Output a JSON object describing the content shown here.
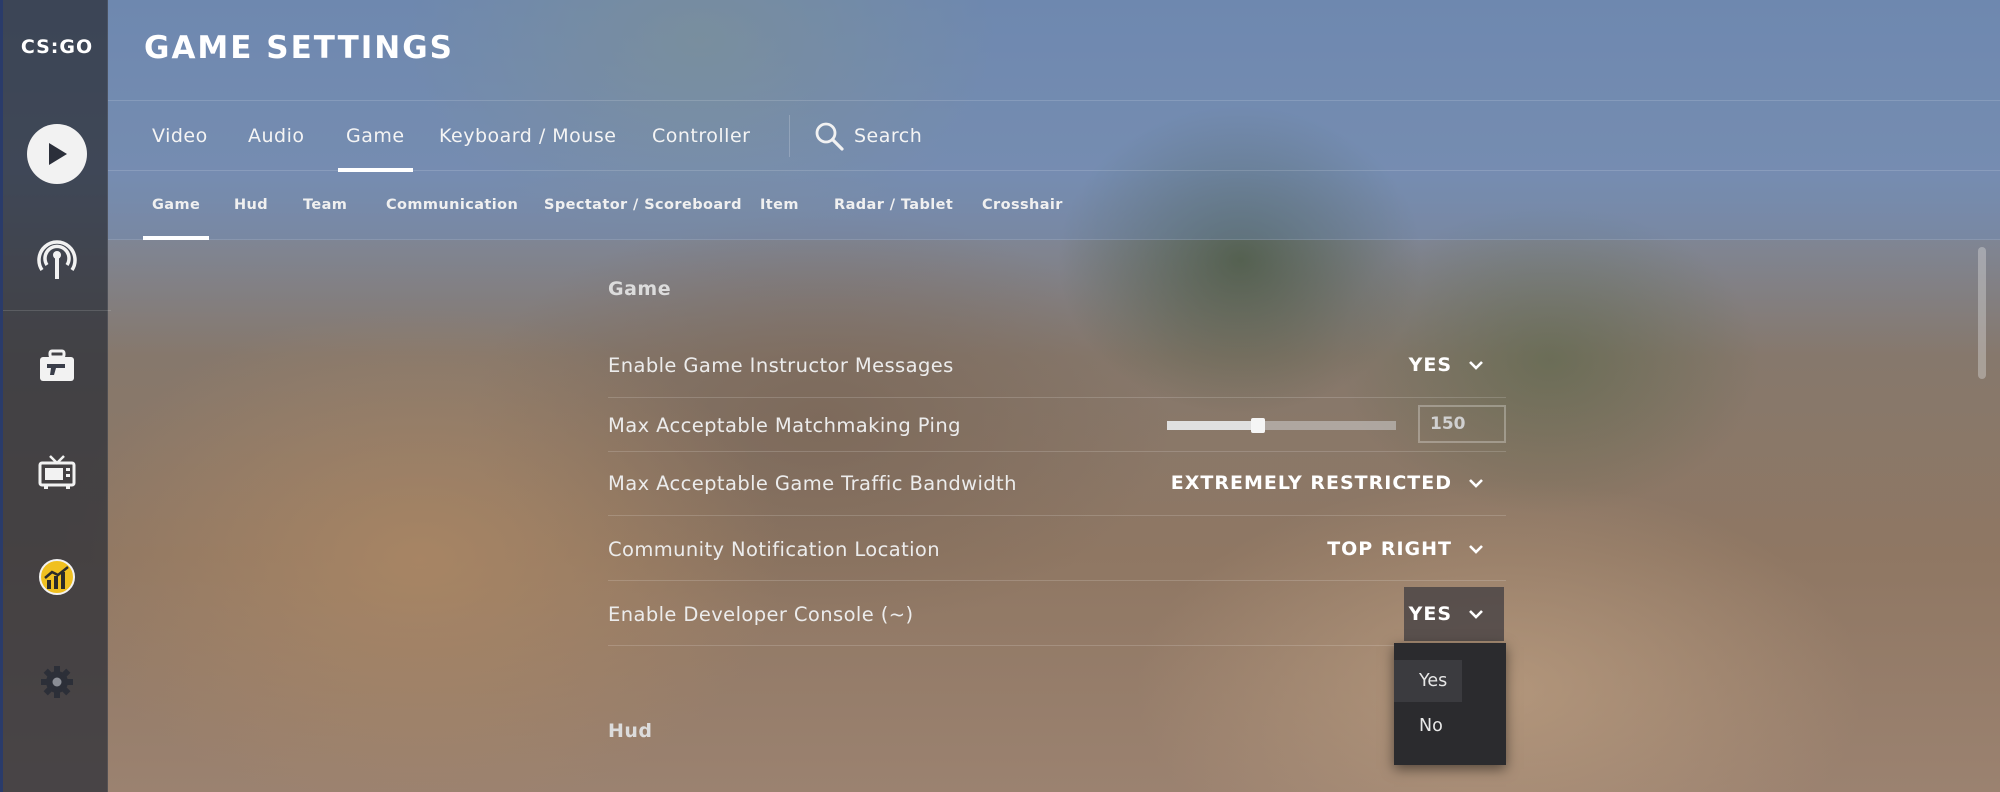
{
  "rail": {
    "logo": "CS:GO",
    "items": [
      "play-icon",
      "broadcast-icon",
      "briefcase-icon",
      "tv-icon",
      "stats-icon",
      "gear-icon"
    ]
  },
  "header": {
    "title": "GAME SETTINGS",
    "tabs": [
      {
        "label": "Video"
      },
      {
        "label": "Audio"
      },
      {
        "label": "Game",
        "active": true
      },
      {
        "label": "Keyboard / Mouse"
      },
      {
        "label": "Controller"
      }
    ],
    "search_label": "Search",
    "subtabs": [
      {
        "label": "Game",
        "active": true
      },
      {
        "label": "Hud"
      },
      {
        "label": "Team"
      },
      {
        "label": "Communication"
      },
      {
        "label": "Spectator / Scoreboard"
      },
      {
        "label": "Item"
      },
      {
        "label": "Radar / Tablet"
      },
      {
        "label": "Crosshair"
      }
    ]
  },
  "content": {
    "sections": [
      {
        "title": "Game",
        "rows": [
          {
            "label": "Enable Game Instructor Messages",
            "value": "YES"
          },
          {
            "label": "Max Acceptable Matchmaking Ping",
            "value": "150",
            "slider_fraction": 0.39
          },
          {
            "label": "Max Acceptable Game Traffic Bandwidth",
            "value": "EXTREMELY RESTRICTED"
          },
          {
            "label": "Community Notification Location",
            "value": "TOP RIGHT"
          },
          {
            "label": "Enable Developer Console (~)",
            "value": "YES"
          }
        ]
      },
      {
        "title": "Hud"
      }
    ],
    "open_dropdown": {
      "options": [
        "Yes",
        "No"
      ],
      "hovered": "Yes"
    }
  },
  "colors": {
    "rail_accent": "#2a3b6a",
    "header_overlay": "#6e8cbe",
    "dropdown_bg": "#2b2b2e"
  }
}
